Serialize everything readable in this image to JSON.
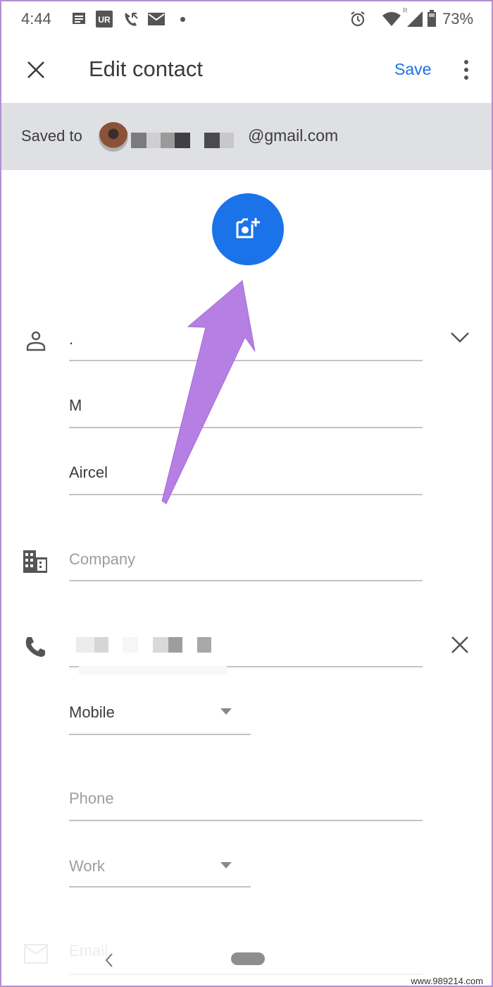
{
  "status_bar": {
    "time": "4:44",
    "left_icons": [
      "messages-icon",
      "ur-app-icon",
      "missed-call-icon",
      "gmail-icon",
      "dot-icon"
    ],
    "right_icons": [
      "alarm-icon",
      "wifi-icon",
      "signal-icon",
      "battery-icon"
    ],
    "signal_roaming_label": "R",
    "battery_percent": "73%"
  },
  "app_bar": {
    "close_icon": "close-icon",
    "title": "Edit contact",
    "save_label": "Save",
    "more_icon": "more-vert-icon"
  },
  "account_banner": {
    "label": "Saved to",
    "email_suffix": "@gmail.com",
    "email_redacted": true
  },
  "photo": {
    "icon": "add-photo-icon"
  },
  "annotation": {
    "arrow_color": "#b57fe3",
    "points_to": "add-photo-button"
  },
  "name_section": {
    "icon": "person-icon",
    "expand_icon": "chevron-down-icon",
    "fields": [
      {
        "name": "prefix-or-first",
        "value": "."
      },
      {
        "name": "middle-name",
        "value": "M"
      },
      {
        "name": "last-name",
        "value": "Aircel"
      }
    ]
  },
  "company_section": {
    "icon": "business-icon",
    "placeholder": "Company",
    "value": ""
  },
  "phone_section": {
    "icon": "phone-icon",
    "remove_icon": "close-icon",
    "number_redacted": true,
    "type_value": "Mobile",
    "new_phone_placeholder": "Phone",
    "new_phone_type": "Work"
  },
  "email_section": {
    "icon": "email-icon",
    "placeholder": "Email"
  },
  "nav_bar": {
    "back_icon": "back-chevron-icon",
    "home_pill": "home-pill"
  },
  "watermark": "www.989214.com",
  "colors": {
    "accent": "#1a73e8",
    "banner_bg": "#dfe0e4",
    "annotation": "#b57fe3"
  }
}
